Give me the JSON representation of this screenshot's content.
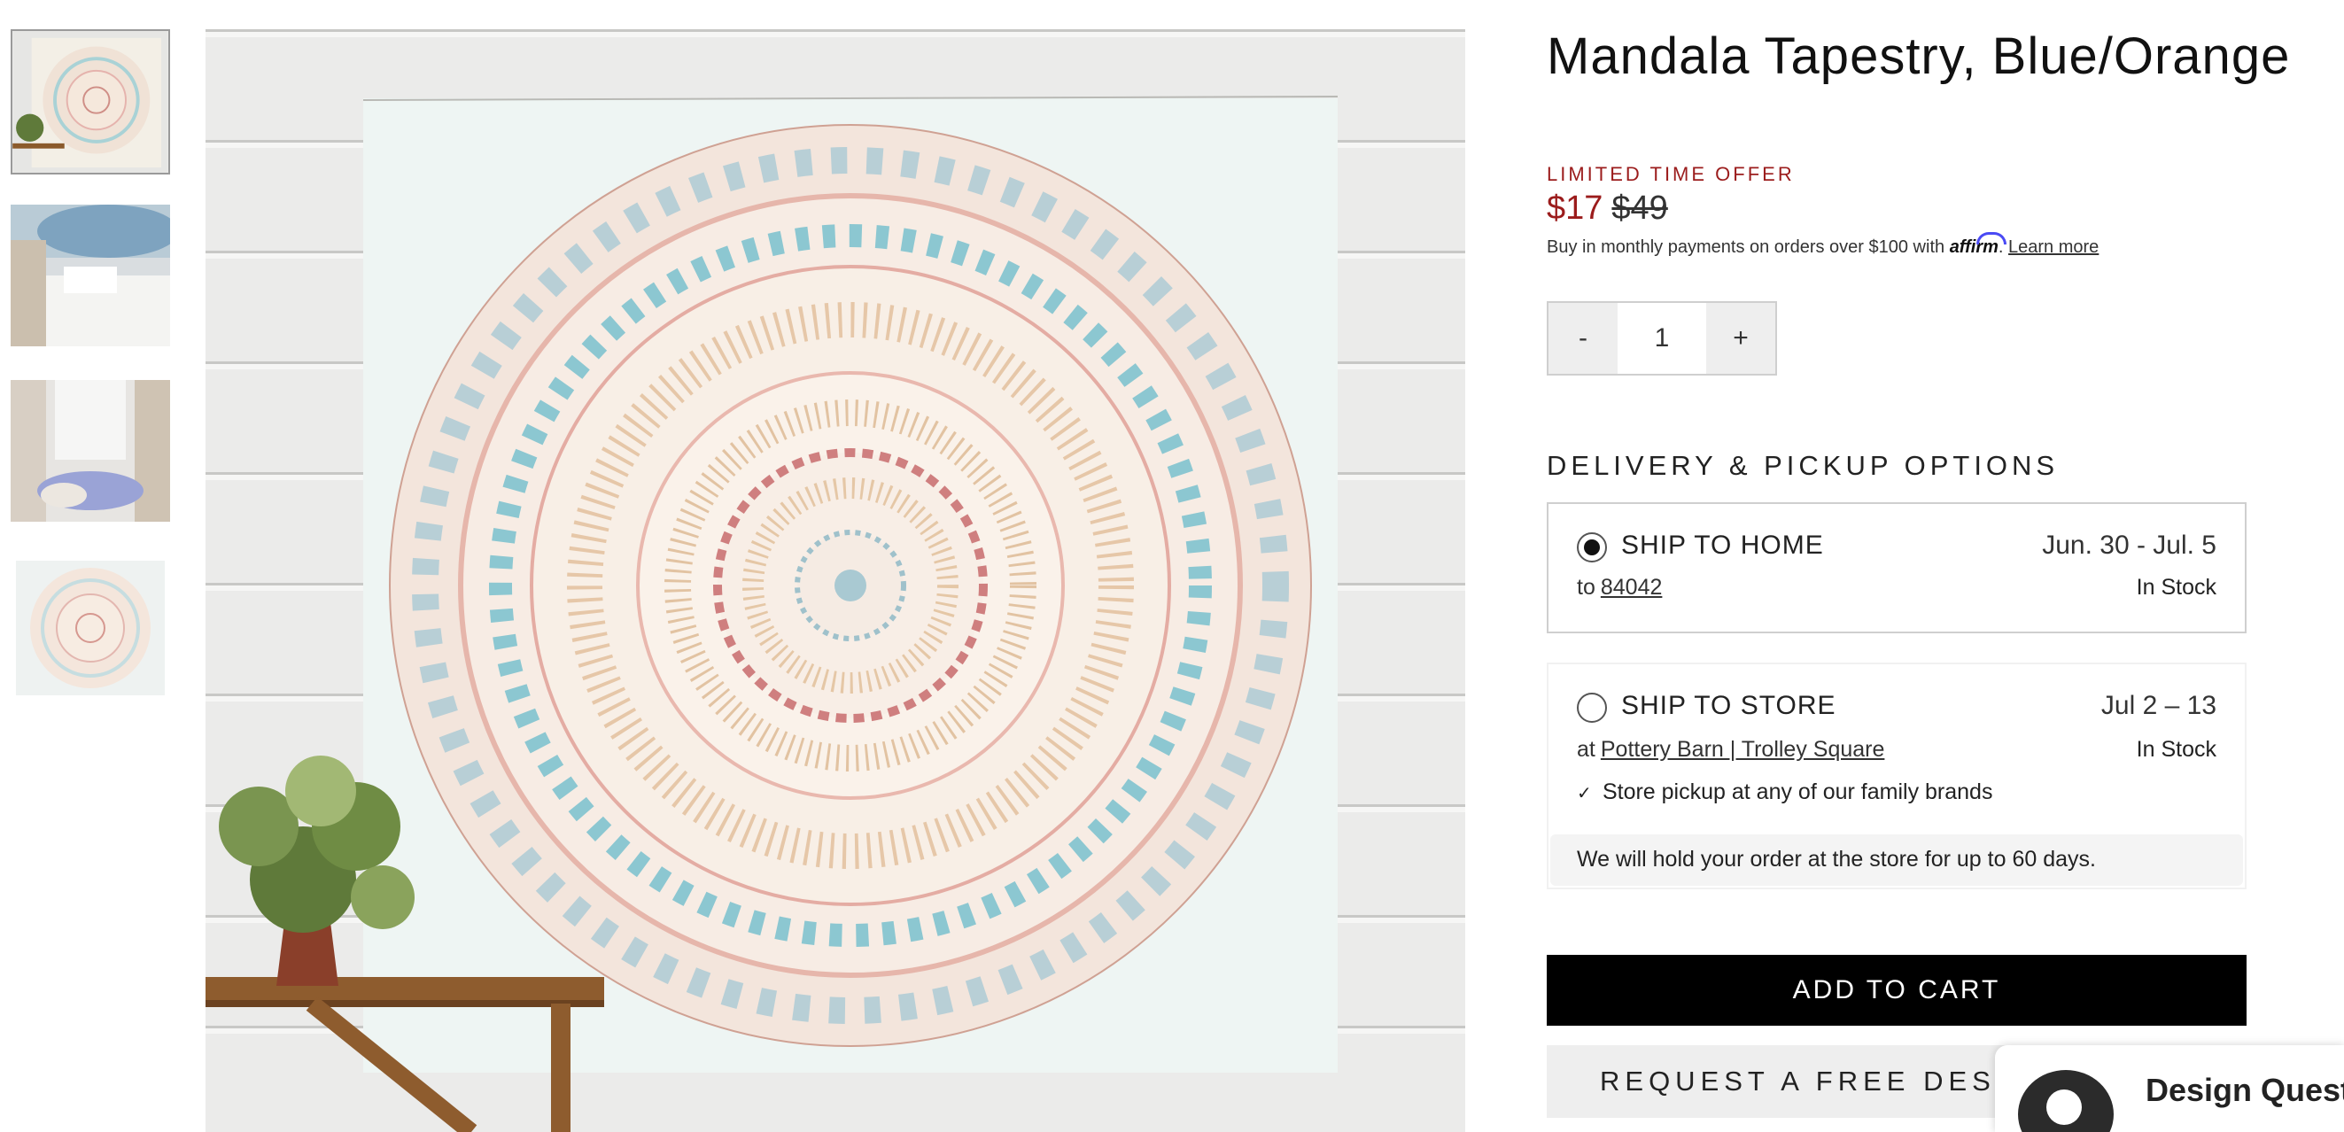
{
  "product": {
    "title": "Mandala Tapestry, Blue/Orange",
    "offer_label": "LIMITED TIME OFFER",
    "sale_price": "$17",
    "original_price": "$49",
    "affirm_text": "Buy in monthly payments on orders over $100 with",
    "affirm_brand": "affirm",
    "affirm_learn_more": "Learn more"
  },
  "quantity": {
    "decrement": "-",
    "value": "1",
    "increment": "+"
  },
  "delivery": {
    "heading": "DELIVERY & PICKUP OPTIONS",
    "ship_home": {
      "title": "SHIP TO HOME",
      "date": "Jun. 30 - Jul. 5",
      "to_prefix": "to",
      "zip": "84042",
      "stock": "In Stock",
      "selected": true
    },
    "ship_store": {
      "title": "SHIP TO STORE",
      "date": "Jul 2 – 13",
      "at_prefix": "at",
      "store_name": "Pottery Barn | Trolley Square",
      "stock": "In Stock",
      "checkmark": "✓",
      "family_brands": "Store pickup at any of our family brands",
      "hold_note": "We will hold your order at the store for up to 60 days.",
      "selected": false
    }
  },
  "actions": {
    "add_to_cart": "ADD TO CART",
    "design_appointment": "REQUEST A FREE DESIGN APPOINTMENT"
  },
  "chat_widget": {
    "label": "Design Questions?"
  },
  "gallery": {
    "thumbnails": [
      "mandala-wall-bench",
      "mandala-bedroom",
      "mandala-lounge",
      "mandala-flat"
    ],
    "active_index": 0
  },
  "colors": {
    "sale_red": "#9b1c1c",
    "cta_black": "#000000",
    "affirm_blue": "#4a4af4"
  }
}
